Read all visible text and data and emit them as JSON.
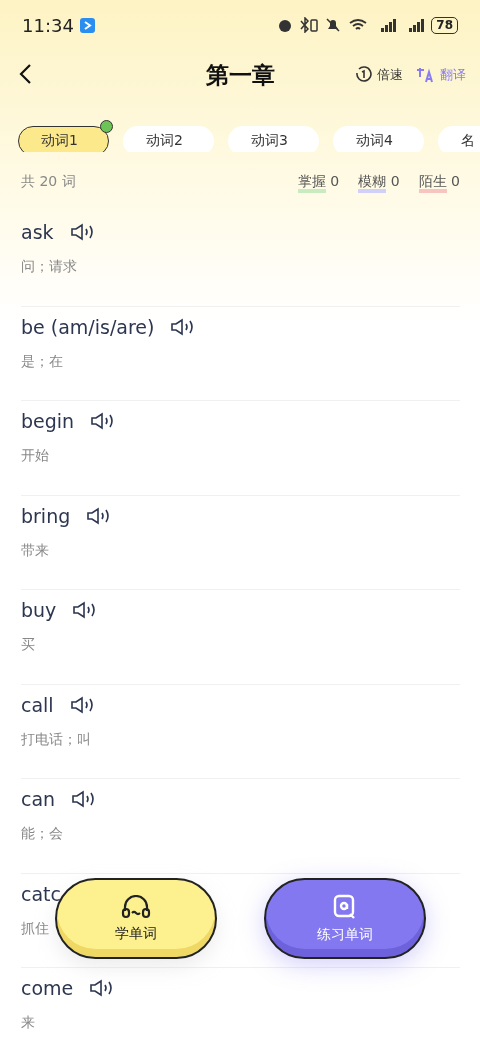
{
  "status_bar": {
    "time": "11:34",
    "battery": "78"
  },
  "header": {
    "title": "第一章",
    "actions": [
      {
        "kind": "speed",
        "label": "倍速"
      },
      {
        "kind": "translate",
        "label": "翻译"
      }
    ]
  },
  "tabs": [
    {
      "label": "动词1",
      "selected": true,
      "badge": true
    },
    {
      "label": "动词2",
      "selected": false,
      "badge": false
    },
    {
      "label": "动词3",
      "selected": false,
      "badge": false
    },
    {
      "label": "动词4",
      "selected": false,
      "badge": false
    },
    {
      "label": "名",
      "selected": false,
      "badge": false
    }
  ],
  "summary": {
    "total": "共 20 词",
    "stats": [
      {
        "label": "掌握",
        "count": "0",
        "color": "#c8ecc0"
      },
      {
        "label": "模糊",
        "count": "0",
        "color": "#d0d0f8"
      },
      {
        "label": "陌生",
        "count": "0",
        "color": "#f8c4c0"
      }
    ]
  },
  "words": [
    {
      "word": "ask",
      "meaning": "问；请求",
      "sound": true
    },
    {
      "word": "be (am/is/are)",
      "meaning": "是；在",
      "sound": true
    },
    {
      "word": "begin",
      "meaning": "开始",
      "sound": true
    },
    {
      "word": "bring",
      "meaning": "带来",
      "sound": true
    },
    {
      "word": "buy",
      "meaning": "买",
      "sound": true
    },
    {
      "word": "call",
      "meaning": "打电话；叫",
      "sound": true
    },
    {
      "word": "can",
      "meaning": "能；会",
      "sound": true
    },
    {
      "word": "catc",
      "meaning": "抓住",
      "sound": false
    },
    {
      "word": "come",
      "meaning": "来",
      "sound": true
    }
  ],
  "actions": [
    {
      "kind": "learn",
      "label": "学单词"
    },
    {
      "kind": "practice",
      "label": "练习单词"
    }
  ]
}
